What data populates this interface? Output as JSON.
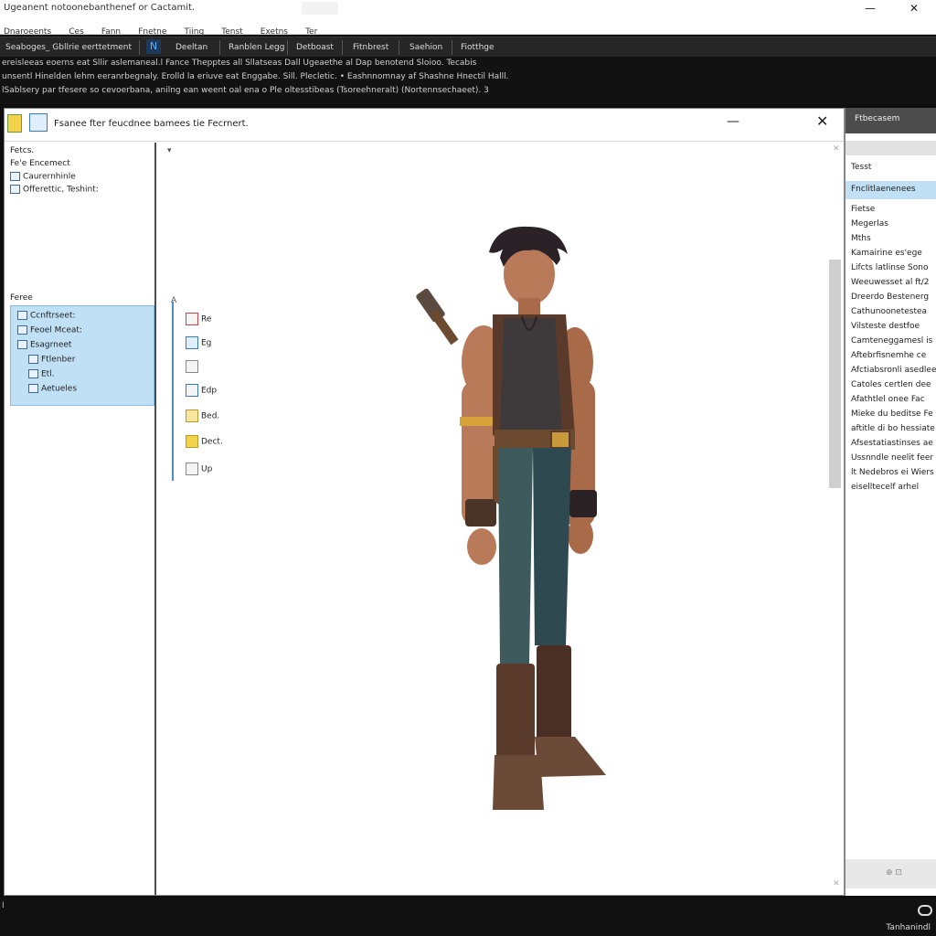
{
  "window": {
    "title": "Ugeanent notoonebanthenef or Cactamit.",
    "minimize_label": "—",
    "close_label": "✕"
  },
  "menubar": [
    "Dnaroeents",
    "Ces",
    "Fann",
    "Fnetne",
    "Tiing",
    "Tenst",
    "Exetns",
    "Ter"
  ],
  "toolbar": {
    "items": [
      "Seaboges_ Gbllrie eerttetment",
      "Deeltan",
      "Ranblen Legg",
      "Detboast",
      "Fitnbrest",
      "Saehion",
      "Fiotthge"
    ]
  },
  "info_lines": [
    "ereisleeas eoerns eat Sllir aslemaneal.l Fance Thepptes all Sllatseas Dall Ugeaethe al Dap benotend Sloioo. Tecabis",
    "unsentl Hinelden lehm eeranrbegnaly. Erolld la eriuve eat Enggabe. Sill. Plecletic. • Eashnnomnay af Shashne Hnectil Halll.",
    "lSablsery par tfesere so cevoerbana, anilng ean weent oal ena o Ple oltesstibeas (Tsoreehneralt) (Nortennsechaeet). 3"
  ],
  "document": {
    "title": "Fsanee fter feucdnee bamees tie Fecrnert.",
    "left_pane": {
      "top_lines": [
        "Fetcs.",
        "Fe'e Encemect",
        "Caurernhinle",
        "Offerettic, Teshint:"
      ],
      "section_label": "Feree",
      "items": [
        "Ccnftrseet:",
        "Feoel Mceat:",
        "Esagrneet",
        "Ftlenber",
        "Etl.",
        "Aetueles"
      ]
    },
    "canvas": {
      "marker_top": "▾",
      "marker_side": "A",
      "items": [
        "Re",
        "Eg",
        "",
        "Edp",
        "Bed.",
        "Dect.",
        "Up"
      ]
    }
  },
  "right_panel": {
    "header": "Ftbecasem",
    "band_label": "Tesst",
    "selected": "Fnclitlaenenees",
    "items": [
      "Fietse",
      "Megerlas",
      "Mths",
      "Kamairine es'ege",
      "Lifcts latlinse Sono",
      "Weeuwesset al ft/2",
      "Dreerdo Bestenerg",
      "Cathunoonetestea",
      "Vilsteste destfoe",
      "Camteneggamesl is",
      "Aftebrfisnemhe ce",
      "Afctiabsronli asedlee",
      "Catoles certlen dee",
      "Afathtlel onee Fac",
      "Mieke du beditse Fe",
      "aftitle di bo hessiate",
      "Afsestatiastinses ae",
      "Ussnndle neelit feer ca",
      "lt Nedebros ei Wiers",
      "eiselltecelf arhel"
    ],
    "footer": "⊕ ⊡"
  },
  "statusbar": {
    "left": "I",
    "right": "Tanhanindl"
  },
  "colors": {
    "accent": "#bfe0f5",
    "toolbar_bg": "#262626"
  }
}
